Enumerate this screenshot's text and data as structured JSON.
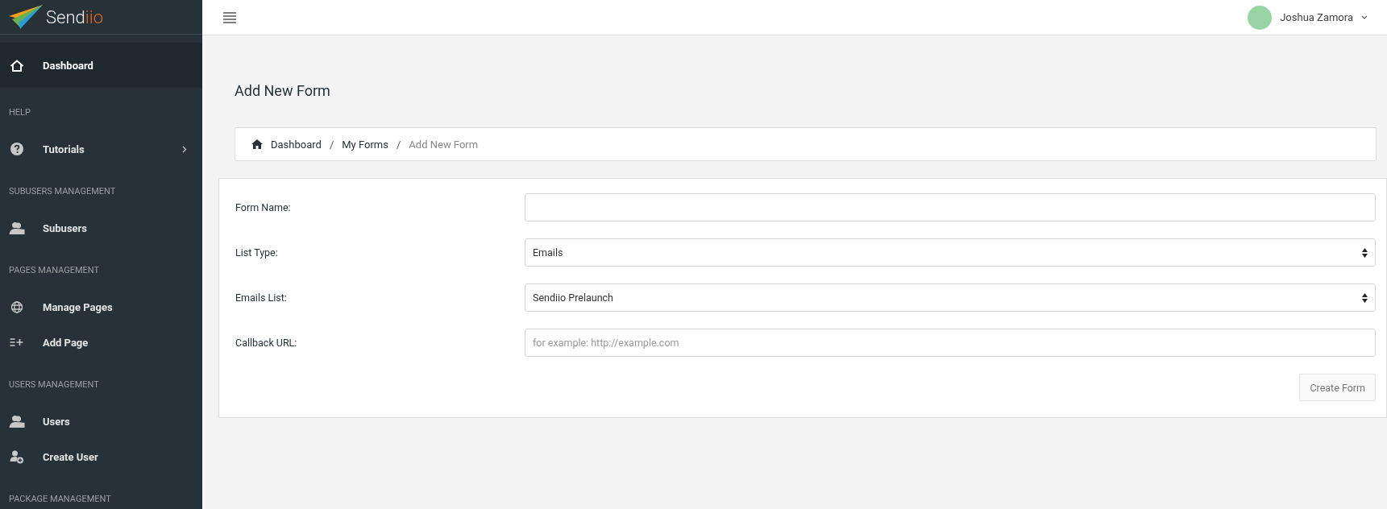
{
  "logo": {
    "text": "Send",
    "accent": "iio"
  },
  "sidebar": {
    "items": [
      {
        "kind": "item",
        "label": "Dashboard",
        "selected": true,
        "expandable": false
      },
      {
        "kind": "section",
        "label": "HELP"
      },
      {
        "kind": "item",
        "label": "Tutorials",
        "selected": false,
        "expandable": true
      },
      {
        "kind": "section",
        "label": "SUBUSERS MANAGEMENT"
      },
      {
        "kind": "item",
        "label": "Subusers",
        "selected": false,
        "expandable": false
      },
      {
        "kind": "section",
        "label": "PAGES MANAGEMENT"
      },
      {
        "kind": "item",
        "label": "Manage Pages",
        "selected": false,
        "expandable": false
      },
      {
        "kind": "item",
        "label": "Add Page",
        "selected": false,
        "expandable": false
      },
      {
        "kind": "section",
        "label": "USERS MANAGEMENT"
      },
      {
        "kind": "item",
        "label": "Users",
        "selected": false,
        "expandable": false
      },
      {
        "kind": "item",
        "label": "Create User",
        "selected": false,
        "expandable": false
      },
      {
        "kind": "section",
        "label": "PACKAGE MANAGEMENT"
      }
    ]
  },
  "user": {
    "name": "Joshua Zamora"
  },
  "page_title": "Add New Form",
  "breadcrumb": [
    {
      "label": "Dashboard",
      "current": false
    },
    {
      "separator": "/",
      "label": "My Forms",
      "current": false
    },
    {
      "separator": "/",
      "label": "Add New Form",
      "current": true
    }
  ],
  "form": {
    "fields": [
      {
        "kind": "text",
        "label": "Form Name:"
      },
      {
        "kind": "select",
        "label": "List Type:",
        "value": "Emails"
      },
      {
        "kind": "select",
        "label": "Emails List:",
        "value": "Sendiio Prelaunch"
      },
      {
        "kind": "text",
        "label": "Callback URL:",
        "placeholder": "for example: http://example.com"
      }
    ],
    "submit": "Create Form"
  }
}
